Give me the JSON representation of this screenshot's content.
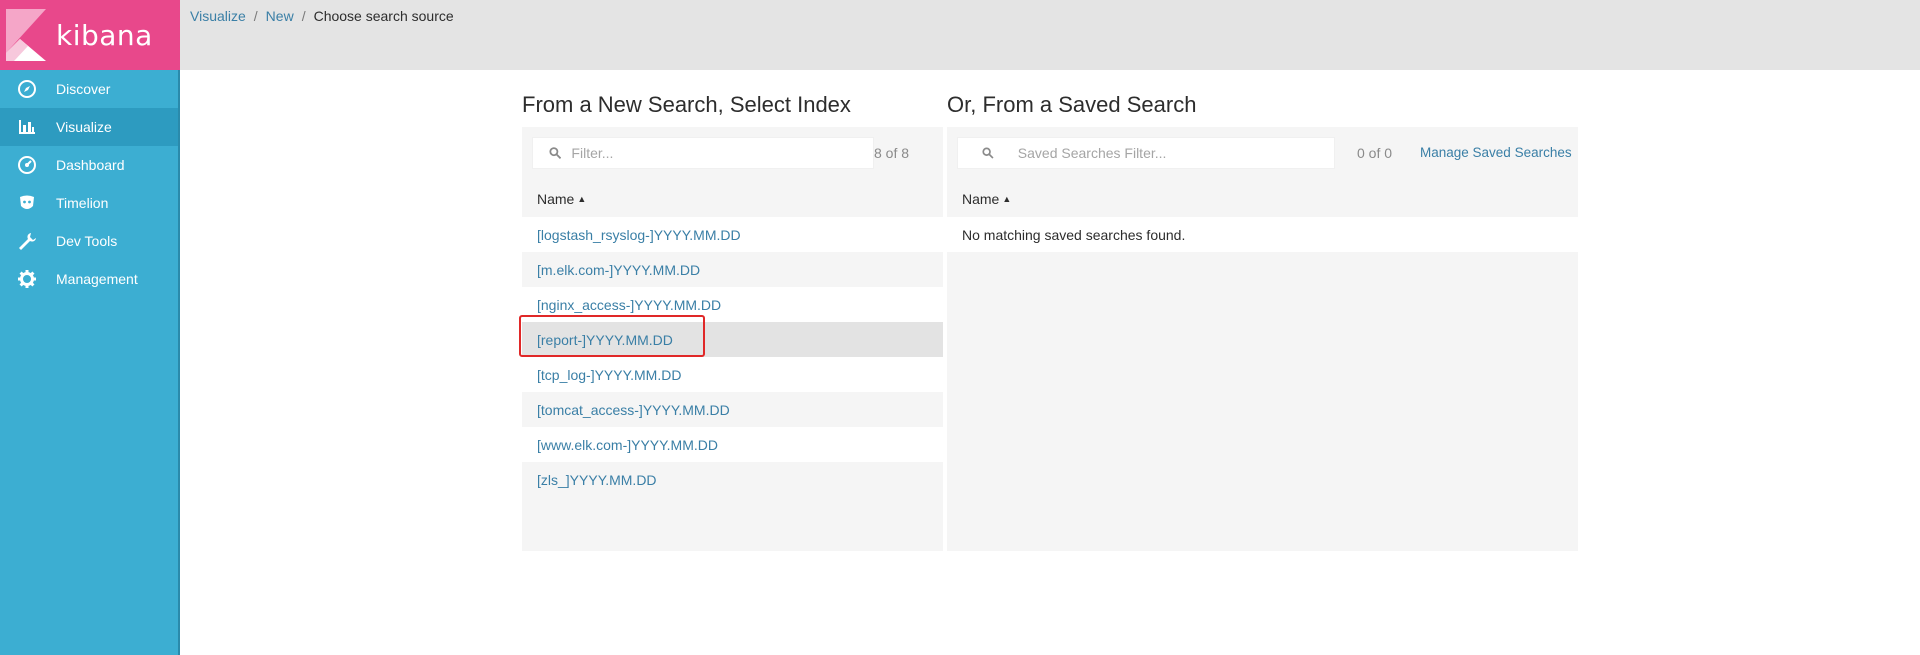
{
  "app": {
    "logo_text": "kibana"
  },
  "sidebar": {
    "items": [
      {
        "label": "Discover",
        "icon": "compass-icon",
        "active": false
      },
      {
        "label": "Visualize",
        "icon": "bar-chart-icon",
        "active": true
      },
      {
        "label": "Dashboard",
        "icon": "dashboard-icon",
        "active": false
      },
      {
        "label": "Timelion",
        "icon": "timelion-icon",
        "active": false
      },
      {
        "label": "Dev Tools",
        "icon": "wrench-icon",
        "active": false
      },
      {
        "label": "Management",
        "icon": "gear-icon",
        "active": false
      }
    ]
  },
  "breadcrumb": {
    "root": "Visualize",
    "middle": "New",
    "current": "Choose search source",
    "sep": "/"
  },
  "new_search": {
    "title": "From a New Search, Select Index",
    "filter_placeholder": "Filter...",
    "count": "8 of 8",
    "column_header": "Name",
    "rows": [
      "[logstash_rsyslog-]YYYY.MM.DD",
      "[m.elk.com-]YYYY.MM.DD",
      "[nginx_access-]YYYY.MM.DD",
      "[report-]YYYY.MM.DD",
      "[tcp_log-]YYYY.MM.DD",
      "[tomcat_access-]YYYY.MM.DD",
      "[www.elk.com-]YYYY.MM.DD",
      "[zls_]YYYY.MM.DD"
    ],
    "highlighted_index": 3
  },
  "saved_search": {
    "title": "Or, From a Saved Search",
    "filter_placeholder": "Saved Searches Filter...",
    "count": "0 of 0",
    "manage_link": "Manage Saved Searches",
    "column_header": "Name",
    "empty_message": "No matching saved searches found."
  },
  "colors": {
    "sidebar": "#3caed2",
    "logo_bg": "#e8488b",
    "link": "#3a7fa6",
    "highlight_border": "#e02828"
  }
}
